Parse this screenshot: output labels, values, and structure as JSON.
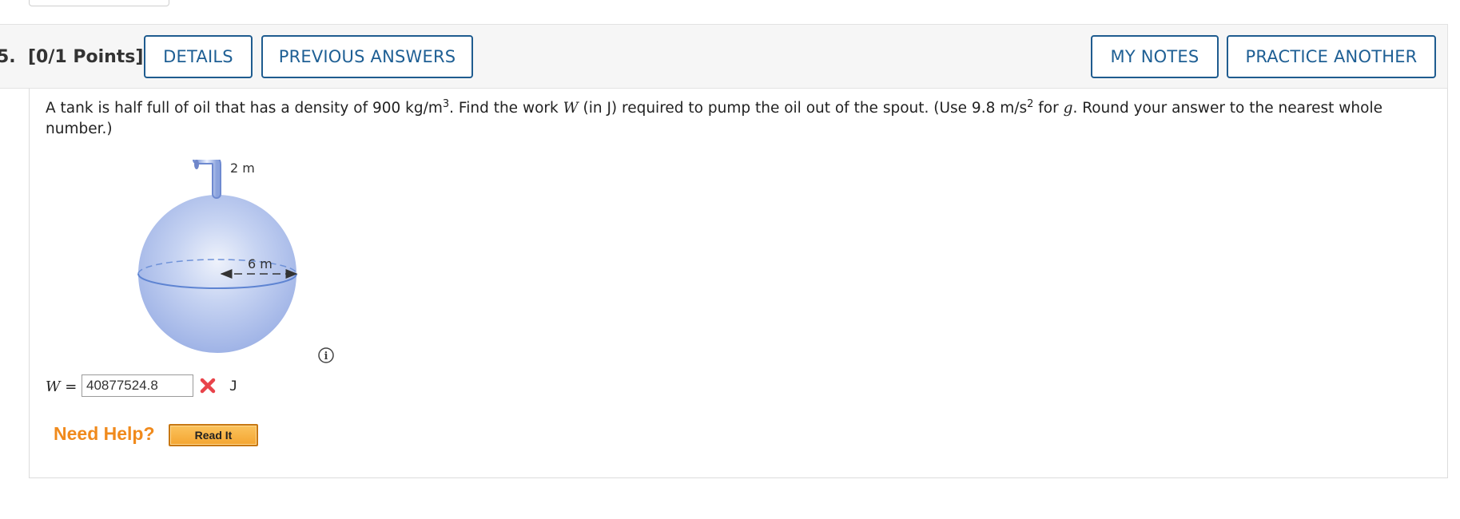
{
  "question": {
    "number_label": "5.  [0/1 Points]",
    "text_part1": "A tank is half full of oil that has a density of 900 kg/m",
    "sup1": "3",
    "text_part2": ". Find the work ",
    "var_w": "W",
    "text_part3": " (in J) required to pump the oil out of the spout. (Use 9.8 m/s",
    "sup2": "2",
    "text_part4": " for ",
    "var_g": "g",
    "text_part5": ". Round your answer to the nearest whole number.)"
  },
  "toolbar": {
    "details_label": "DETAILS",
    "previous_answers_label": "PREVIOUS ANSWERS",
    "my_notes_label": "MY NOTES",
    "practice_another_label": "PRACTICE ANOTHER"
  },
  "figure": {
    "spout_label": "2 m",
    "radius_label": "6 m",
    "tank_color": "#aabbe8",
    "spout_color": "#9fb4e6"
  },
  "answer": {
    "var_label": "W",
    "equals": " = ",
    "value": "40877524.8",
    "unit": "J",
    "status": "incorrect",
    "status_icon": "red-x-icon"
  },
  "help": {
    "need_help_label": "Need Help?",
    "read_it_label": "Read It"
  },
  "colors": {
    "accent": "#1e5f94",
    "help_orange": "#f08a1c",
    "wrong_red": "#e8434a"
  }
}
